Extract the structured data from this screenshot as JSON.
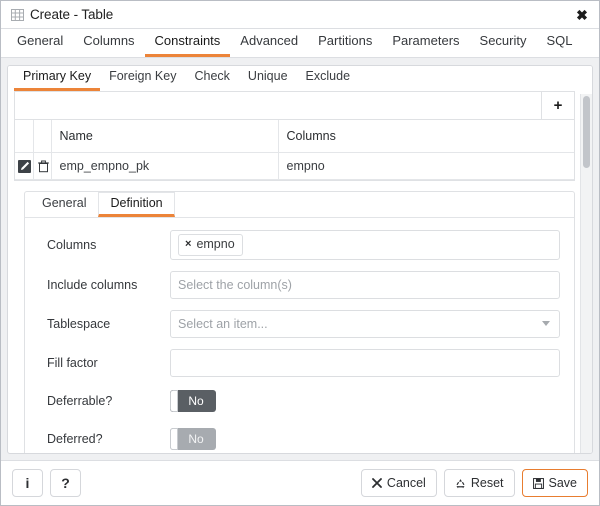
{
  "window": {
    "title": "Create - Table",
    "title_icon": "table-grid-icon",
    "close_icon": "close-icon"
  },
  "main_tabs": [
    {
      "label": "General",
      "active": false
    },
    {
      "label": "Columns",
      "active": false
    },
    {
      "label": "Constraints",
      "active": true
    },
    {
      "label": "Advanced",
      "active": false
    },
    {
      "label": "Partitions",
      "active": false
    },
    {
      "label": "Parameters",
      "active": false
    },
    {
      "label": "Security",
      "active": false
    },
    {
      "label": "SQL",
      "active": false
    }
  ],
  "sub_tabs": [
    {
      "label": "Primary Key",
      "active": true
    },
    {
      "label": "Foreign Key",
      "active": false
    },
    {
      "label": "Check",
      "active": false
    },
    {
      "label": "Unique",
      "active": false
    },
    {
      "label": "Exclude",
      "active": false
    }
  ],
  "grid": {
    "add_label": "+",
    "headers": {
      "edit": "",
      "delete": "",
      "name": "Name",
      "columns": "Columns"
    },
    "rows": [
      {
        "name": "emp_empno_pk",
        "columns": "empno"
      }
    ]
  },
  "detail": {
    "tabs": [
      {
        "label": "General",
        "active": false
      },
      {
        "label": "Definition",
        "active": true
      }
    ],
    "fields": {
      "columns": {
        "label": "Columns",
        "chips": [
          {
            "text": "empno",
            "remove": "×"
          }
        ]
      },
      "include_columns": {
        "label": "Include columns",
        "value": "",
        "placeholder": "Select the column(s)"
      },
      "tablespace": {
        "label": "Tablespace",
        "value": "",
        "placeholder": "Select an item..."
      },
      "fill_factor": {
        "label": "Fill factor",
        "value": "",
        "placeholder": ""
      },
      "deferrable": {
        "label": "Deferrable?",
        "value": "No"
      },
      "deferred": {
        "label": "Deferred?",
        "value": "No"
      }
    }
  },
  "footer": {
    "info_label": "i",
    "help_label": "?",
    "cancel_label": "Cancel",
    "reset_label": "Reset",
    "save_label": "Save"
  },
  "colors": {
    "accent": "#ec8439",
    "save_border": "#e87d30",
    "toggle_on": "#5a5f64",
    "toggle_disabled": "#a7abb0",
    "panel_bg": "#eff0f2"
  }
}
